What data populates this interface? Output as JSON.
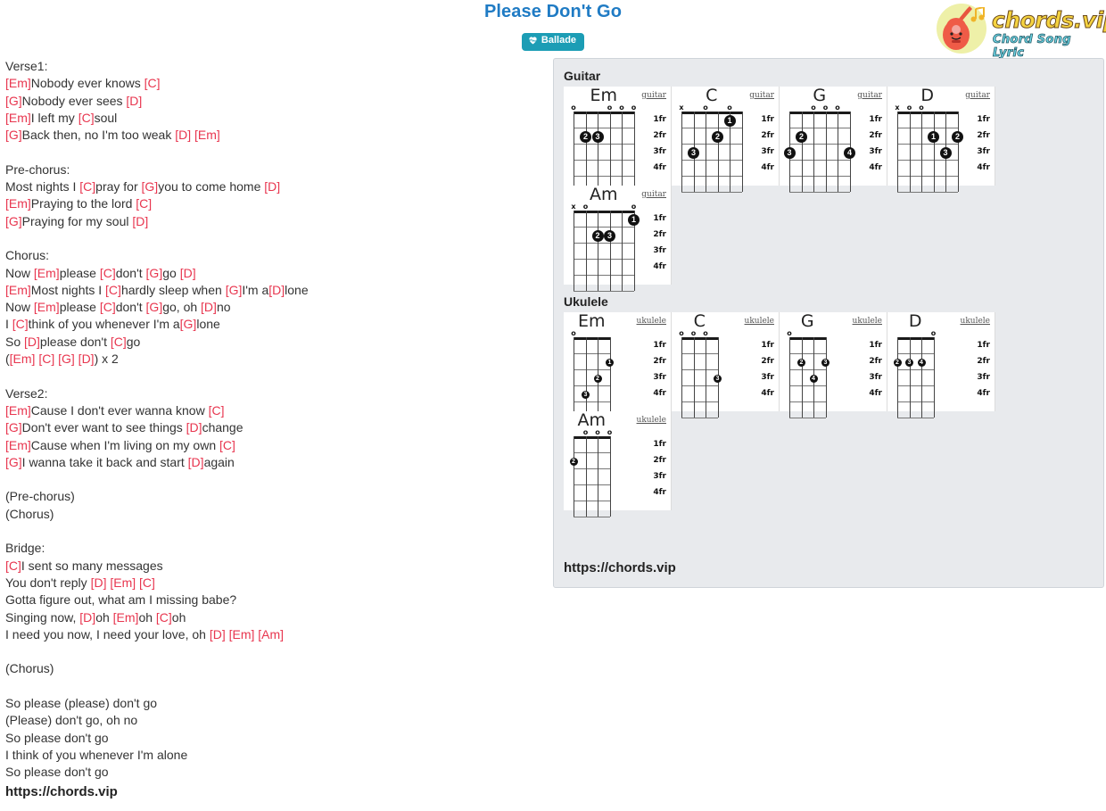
{
  "header": {
    "title": "Please Don't Go",
    "badge": {
      "label": "Ballade",
      "icon": "heartbeat-icon",
      "color": "#1c9db5"
    },
    "title_color": "#1f7bc4"
  },
  "logo": {
    "wordmark": "chords.vip",
    "tagline": "Chord Song Lyric",
    "icon": "guitar-icon",
    "wordmark_color": "#f5d340",
    "tagline_color": "#6fd8e8"
  },
  "lyrics": {
    "chord_color": "#e8364f",
    "lines": [
      [
        {
          "t": "Verse1:"
        }
      ],
      [
        {
          "c": "[Em]"
        },
        {
          "t": "Nobody ever knows "
        },
        {
          "c": "[C]"
        }
      ],
      [
        {
          "c": "[G]"
        },
        {
          "t": "Nobody ever sees "
        },
        {
          "c": "[D]"
        }
      ],
      [
        {
          "c": "[Em]"
        },
        {
          "t": "I left my "
        },
        {
          "c": "[C]"
        },
        {
          "t": "soul"
        }
      ],
      [
        {
          "c": "[G]"
        },
        {
          "t": "Back then, no I'm too weak "
        },
        {
          "c": "[D] [Em]"
        }
      ],
      [],
      [
        {
          "t": "Pre-chorus:"
        }
      ],
      [
        {
          "t": "Most nights I "
        },
        {
          "c": "[C]"
        },
        {
          "t": "pray for "
        },
        {
          "c": "[G]"
        },
        {
          "t": "you to come home "
        },
        {
          "c": "[D]"
        }
      ],
      [
        {
          "c": "[Em]"
        },
        {
          "t": "Praying to the lord "
        },
        {
          "c": "[C]"
        }
      ],
      [
        {
          "c": "[G]"
        },
        {
          "t": "Praying for my soul "
        },
        {
          "c": "[D]"
        }
      ],
      [],
      [
        {
          "t": "Chorus:"
        }
      ],
      [
        {
          "t": "Now "
        },
        {
          "c": "[Em]"
        },
        {
          "t": "please "
        },
        {
          "c": "[C]"
        },
        {
          "t": "don't "
        },
        {
          "c": "[G]"
        },
        {
          "t": "go "
        },
        {
          "c": "[D]"
        }
      ],
      [
        {
          "c": "[Em]"
        },
        {
          "t": "Most nights I "
        },
        {
          "c": "[C]"
        },
        {
          "t": "hardly sleep when "
        },
        {
          "c": "[G]"
        },
        {
          "t": "I'm a"
        },
        {
          "c": "[D]"
        },
        {
          "t": "lone"
        }
      ],
      [
        {
          "t": "Now "
        },
        {
          "c": "[Em]"
        },
        {
          "t": "please "
        },
        {
          "c": "[C]"
        },
        {
          "t": "don't "
        },
        {
          "c": "[G]"
        },
        {
          "t": "go, oh "
        },
        {
          "c": "[D]"
        },
        {
          "t": "no"
        }
      ],
      [
        {
          "t": "I "
        },
        {
          "c": "[C]"
        },
        {
          "t": "think of you whenever I'm a"
        },
        {
          "c": "[G]"
        },
        {
          "t": "lone"
        }
      ],
      [
        {
          "t": "So "
        },
        {
          "c": "[D]"
        },
        {
          "t": "please don't "
        },
        {
          "c": "[C]"
        },
        {
          "t": "go"
        }
      ],
      [
        {
          "t": "("
        },
        {
          "c": "[Em] [C] [G] [D]"
        },
        {
          "t": ") x 2"
        }
      ],
      [],
      [
        {
          "t": "Verse2:"
        }
      ],
      [
        {
          "c": "[Em]"
        },
        {
          "t": "Cause I don't ever wanna know "
        },
        {
          "c": "[C]"
        }
      ],
      [
        {
          "c": "[G]"
        },
        {
          "t": "Don't ever want to see things "
        },
        {
          "c": "[D]"
        },
        {
          "t": "change"
        }
      ],
      [
        {
          "c": "[Em]"
        },
        {
          "t": "Cause when I'm living on my own "
        },
        {
          "c": "[C]"
        }
      ],
      [
        {
          "c": "[G]"
        },
        {
          "t": "I wanna take it back and start "
        },
        {
          "c": "[D]"
        },
        {
          "t": "again"
        }
      ],
      [],
      [
        {
          "t": "(Pre-chorus)"
        }
      ],
      [
        {
          "t": "(Chorus)"
        }
      ],
      [],
      [
        {
          "t": "Bridge:"
        }
      ],
      [
        {
          "c": "[C]"
        },
        {
          "t": "I sent so many messages"
        }
      ],
      [
        {
          "t": "You don't reply "
        },
        {
          "c": "[D] [Em] [C]"
        }
      ],
      [
        {
          "t": "Gotta figure out, what am I missing babe?"
        }
      ],
      [
        {
          "t": "Singing now, "
        },
        {
          "c": "[D]"
        },
        {
          "t": "oh "
        },
        {
          "c": "[Em]"
        },
        {
          "t": "oh "
        },
        {
          "c": "[C]"
        },
        {
          "t": "oh"
        }
      ],
      [
        {
          "t": "I need you now, I need your love, oh "
        },
        {
          "c": "[D] [Em] [Am]"
        }
      ],
      [],
      [
        {
          "t": "(Chorus)"
        }
      ],
      [],
      [
        {
          "t": "So please (please) don't go"
        }
      ],
      [
        {
          "t": "(Please) don't go, oh no"
        }
      ],
      [
        {
          "t": "So please don't go"
        }
      ],
      [
        {
          "t": "I think of you whenever I'm alone"
        }
      ],
      [
        {
          "t": "So please don't go"
        }
      ]
    ],
    "footer_url": "https://chords.vip"
  },
  "chord_panel": {
    "url": "https://chords.vip",
    "fret_labels": [
      "1fr",
      "2fr",
      "3fr",
      "4fr"
    ],
    "sections": [
      {
        "label": "Guitar",
        "instrument_tag": "guitar",
        "strings": 6,
        "chords": [
          {
            "name": "Em",
            "marks": [
              "o",
              "",
              "",
              "o",
              "o",
              "o"
            ],
            "dots": [
              {
                "string": 2,
                "fret": 2,
                "finger": "2"
              },
              {
                "string": 3,
                "fret": 2,
                "finger": "3"
              }
            ]
          },
          {
            "name": "C",
            "marks": [
              "x",
              "",
              "o",
              "",
              "o",
              ""
            ],
            "dots": [
              {
                "string": 5,
                "fret": 1,
                "finger": "1"
              },
              {
                "string": 4,
                "fret": 2,
                "finger": "2"
              },
              {
                "string": 2,
                "fret": 3,
                "finger": "3"
              }
            ]
          },
          {
            "name": "G",
            "marks": [
              "",
              "",
              "o",
              "o",
              "o",
              ""
            ],
            "dots": [
              {
                "string": 2,
                "fret": 2,
                "finger": "2"
              },
              {
                "string": 1,
                "fret": 3,
                "finger": "3"
              },
              {
                "string": 6,
                "fret": 3,
                "finger": "4"
              }
            ]
          },
          {
            "name": "D",
            "marks": [
              "x",
              "o",
              "o",
              "",
              "",
              ""
            ],
            "dots": [
              {
                "string": 4,
                "fret": 2,
                "finger": "1"
              },
              {
                "string": 6,
                "fret": 2,
                "finger": "2"
              },
              {
                "string": 5,
                "fret": 3,
                "finger": "3"
              }
            ]
          },
          {
            "name": "Am",
            "marks": [
              "x",
              "o",
              "",
              "",
              "",
              "o"
            ],
            "dots": [
              {
                "string": 6,
                "fret": 1,
                "finger": "1"
              },
              {
                "string": 3,
                "fret": 2,
                "finger": "2"
              },
              {
                "string": 4,
                "fret": 2,
                "finger": "3"
              }
            ]
          }
        ]
      },
      {
        "label": "Ukulele",
        "instrument_tag": "ukulele",
        "strings": 4,
        "chords": [
          {
            "name": "Em",
            "marks": [
              "o",
              "",
              "",
              ""
            ],
            "dots": [
              {
                "string": 4,
                "fret": 2,
                "finger": "1"
              },
              {
                "string": 3,
                "fret": 3,
                "finger": "2"
              },
              {
                "string": 2,
                "fret": 4,
                "finger": "3"
              }
            ]
          },
          {
            "name": "C",
            "marks": [
              "o",
              "o",
              "o",
              ""
            ],
            "dots": [
              {
                "string": 4,
                "fret": 3,
                "finger": "3"
              }
            ]
          },
          {
            "name": "G",
            "marks": [
              "o",
              "",
              "",
              ""
            ],
            "dots": [
              {
                "string": 2,
                "fret": 2,
                "finger": "2"
              },
              {
                "string": 4,
                "fret": 2,
                "finger": "3"
              },
              {
                "string": 3,
                "fret": 3,
                "finger": "4"
              }
            ]
          },
          {
            "name": "D",
            "marks": [
              "",
              "",
              "",
              "o"
            ],
            "dots": [
              {
                "string": 1,
                "fret": 2,
                "finger": "2"
              },
              {
                "string": 2,
                "fret": 2,
                "finger": "3"
              },
              {
                "string": 3,
                "fret": 2,
                "finger": "4"
              }
            ]
          },
          {
            "name": "Am",
            "marks": [
              "",
              "o",
              "o",
              "o"
            ],
            "dots": [
              {
                "string": 1,
                "fret": 2,
                "finger": "2"
              }
            ]
          }
        ]
      }
    ]
  }
}
